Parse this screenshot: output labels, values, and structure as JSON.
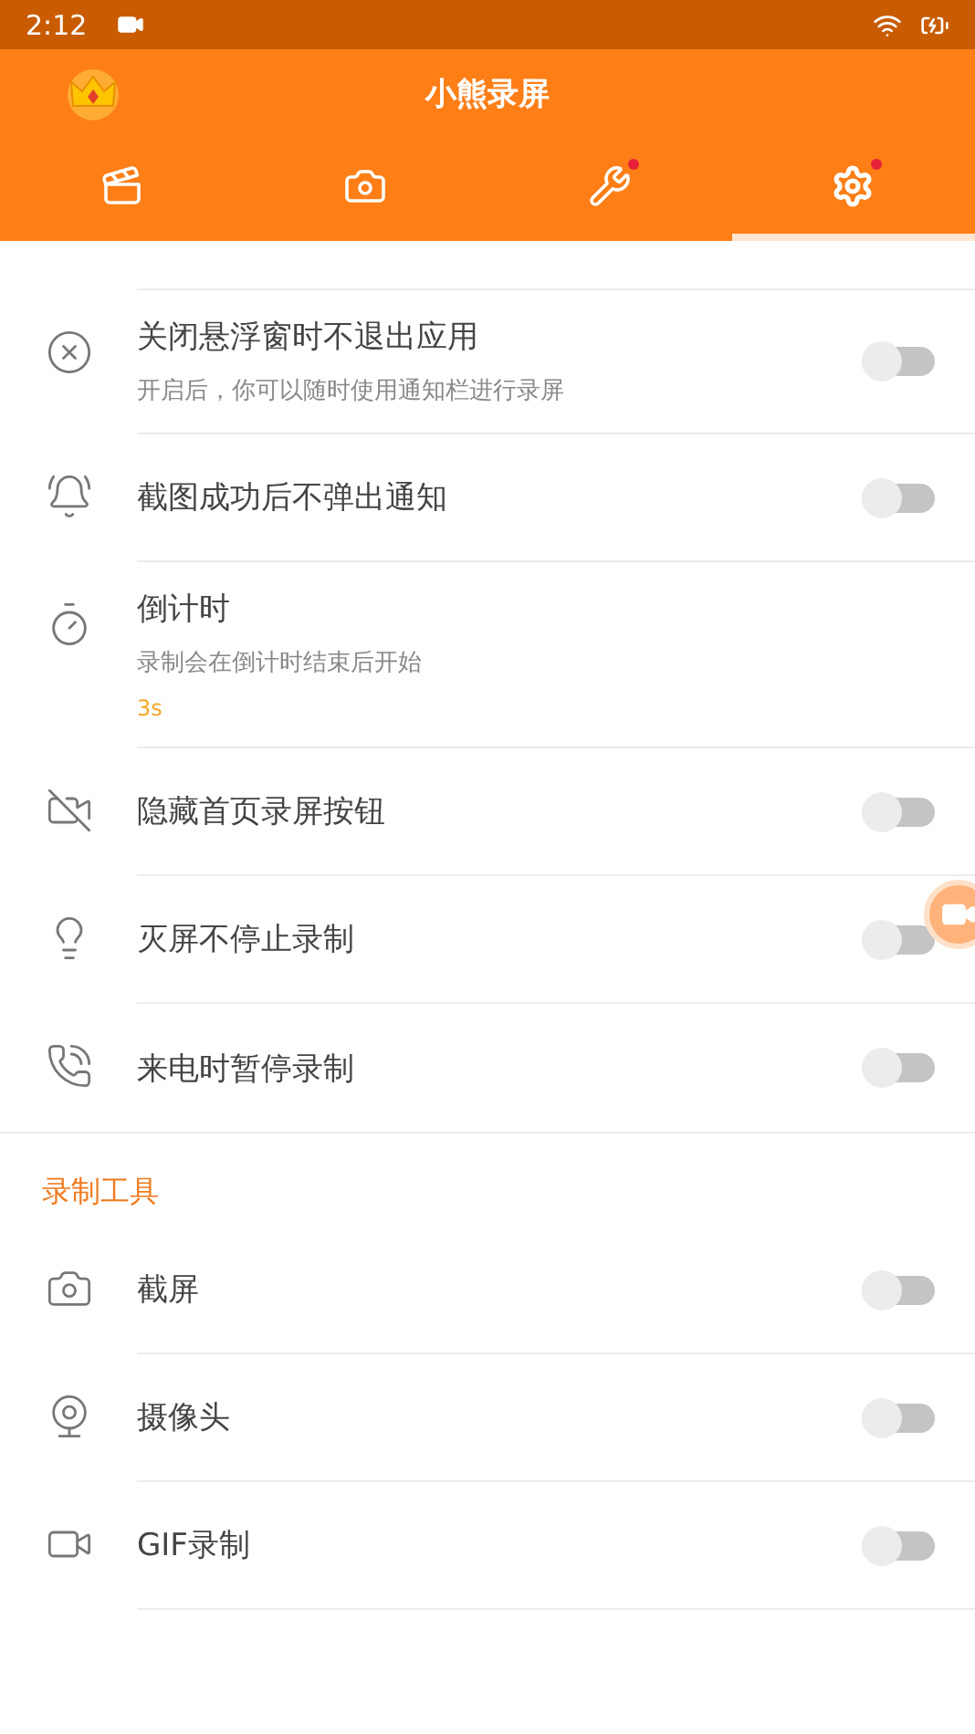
{
  "status_bar": {
    "time": "2:12"
  },
  "header": {
    "title": "小熊录屏"
  },
  "tabs": [
    {
      "selected": false,
      "badge": false
    },
    {
      "selected": false,
      "badge": false
    },
    {
      "selected": false,
      "badge": true
    },
    {
      "selected": true,
      "badge": true
    }
  ],
  "settings": [
    {
      "title": "关闭悬浮窗时不退出应用",
      "subtitle": "开启后，你可以随时使用通知栏进行录屏",
      "kind": "toggle",
      "on": false
    },
    {
      "title": "截图成功后不弹出通知",
      "kind": "toggle",
      "on": false
    },
    {
      "title": "倒计时",
      "subtitle": "录制会在倒计时结束后开始",
      "value": "3s",
      "kind": "value"
    },
    {
      "title": "隐藏首页录屏按钮",
      "kind": "toggle",
      "on": false
    },
    {
      "title": "灭屏不停止录制",
      "kind": "toggle",
      "on": false
    },
    {
      "title": "来电时暂停录制",
      "kind": "toggle",
      "on": false
    }
  ],
  "tools_section": {
    "heading": "录制工具",
    "items": [
      {
        "title": "截屏",
        "kind": "toggle",
        "on": false
      },
      {
        "title": "摄像头",
        "kind": "toggle",
        "on": false
      },
      {
        "title": "GIF录制",
        "kind": "toggle",
        "on": false
      }
    ]
  }
}
